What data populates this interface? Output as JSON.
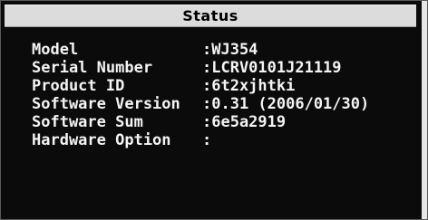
{
  "window": {
    "title": "Status"
  },
  "status_rows": [
    {
      "label": "Model",
      "value": ":WJ354"
    },
    {
      "label": "Serial Number",
      "value": ":LCRV0101J21119"
    },
    {
      "label": "Product ID",
      "value": ":6t2xjhtki"
    },
    {
      "label": "Software Version",
      "value": ":0.31 (2006/01/30)"
    },
    {
      "label": "Software Sum",
      "value": ":6e5a2919"
    },
    {
      "label": "Hardware Option",
      "value": ":"
    }
  ]
}
